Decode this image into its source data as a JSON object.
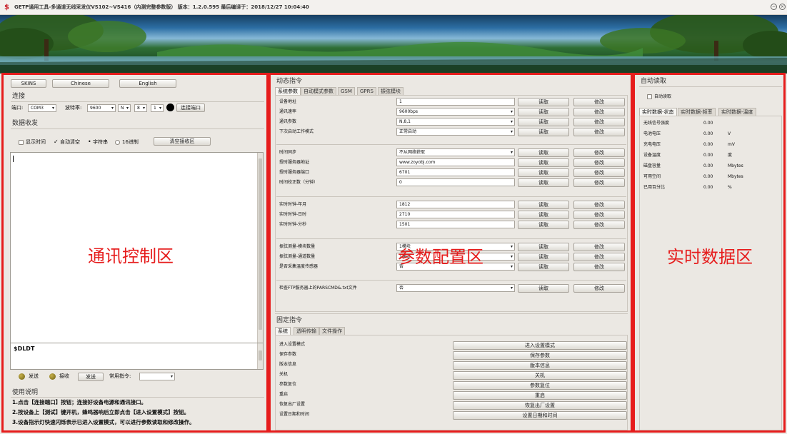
{
  "window": {
    "title": "GETP通用工具-多通道无线采发仪VS102~VS416（内测完整参数版） 版本：1.2.0.595 最后编译于：2018/12/27 10:04:40",
    "min_label": "−",
    "close_label": "×"
  },
  "left": {
    "skins_label": "SKINS",
    "chinese_label": "Chinese",
    "english_label": "English",
    "connect_title": "连接",
    "port_label": "端口:",
    "port_value": "COM3",
    "baud_label": "波特率:",
    "baud_value": "9600",
    "parity_value": "N",
    "databits_value": "8",
    "stopbits_value": "1",
    "connect_button": "连接端口",
    "recv_title": "数据收发",
    "show_time_label": "显示时间",
    "auto_clear_label": "自动清空",
    "string_label": "字符串",
    "hex_label": "16进制",
    "clear_button": "清空接收区",
    "overlay": "通讯控制区",
    "send_text": "$DLDT",
    "send_led_label": "发送",
    "recv_led_label": "接收",
    "send_button": "发送",
    "common_cmd_label": "常用指令:",
    "help_title": "使用说明",
    "help_lines": [
      "1.点击【连接端口】按钮；连接好设备电源和通讯接口。",
      "2.按设备上【测试】键开机，蜂鸣器响后立即点击【进入设置模式】按钮。",
      "3.设备指示灯快速闪烁表示已进入设置模式，可以进行参数读取和修改操作。"
    ]
  },
  "middle": {
    "dynamic_title": "动态指令",
    "tabs": [
      "系统参数",
      "自动模式参数",
      "GSM",
      "GPRS",
      "振弦模块"
    ],
    "read_label": "读取",
    "modify_label": "修改",
    "overlay": "参数配置区",
    "groups": [
      {
        "rows": [
          {
            "label": "设备地址",
            "kind": "input",
            "value": "1"
          },
          {
            "label": "通讯速率",
            "kind": "combo",
            "value": "9600bps"
          },
          {
            "label": "通讯参数",
            "kind": "combo",
            "value": "N,8,1"
          },
          {
            "label": "下次启动工作模式",
            "kind": "combo",
            "value": "正常启动"
          }
        ]
      },
      {
        "rows": [
          {
            "label": "时间同步",
            "kind": "combo",
            "value": "不从网络获取"
          },
          {
            "label": "授时服务器地址",
            "kind": "input",
            "value": "www.zoyobj.com"
          },
          {
            "label": "授时服务器端口",
            "kind": "input",
            "value": "6701"
          },
          {
            "label": "时间校正数（分钟）",
            "kind": "input",
            "value": "0"
          }
        ]
      },
      {
        "rows": [
          {
            "label": "实时时钟-年月",
            "kind": "input",
            "value": "1812"
          },
          {
            "label": "实时时钟-日时",
            "kind": "input",
            "value": "2710"
          },
          {
            "label": "实时时钟-分秒",
            "kind": "input",
            "value": "1501"
          }
        ]
      },
      {
        "rows": [
          {
            "label": "振弦测量-模块数量",
            "kind": "combo",
            "value": "1模块"
          },
          {
            "label": "振弦测量-通道数量",
            "kind": "combo",
            "value": "1通道"
          },
          {
            "label": "是否采集温度传感器",
            "kind": "combo",
            "value": "否"
          }
        ]
      },
      {
        "rows": [
          {
            "label": "检查FTP服务器上的PARSCMD&.txt文件",
            "kind": "combo",
            "value": "否"
          }
        ]
      }
    ],
    "fixed_title": "固定指令",
    "fixed_tabs": [
      "系统",
      "透明传输",
      "文件操作"
    ],
    "fixed_rows": [
      {
        "label": "进入设置模式",
        "button": "进入设置模式"
      },
      {
        "label": "保存参数",
        "button": "保存参数"
      },
      {
        "label": "版本信息",
        "button": "版本信息"
      },
      {
        "label": "关机",
        "button": "关机"
      },
      {
        "label": "参数复位",
        "button": "参数复位"
      },
      {
        "label": "重启",
        "button": "重启"
      },
      {
        "label": "恢复出厂设置",
        "button": "恢复出厂设置"
      },
      {
        "label": "设置日期和时间",
        "button": "设置日期和时间"
      }
    ]
  },
  "right": {
    "title": "自动读取",
    "auto_read_label": "自动读取",
    "tabs": [
      "实时数据-状态",
      "实时数据-频率",
      "实时数据-温度"
    ],
    "overlay": "实时数据区",
    "rows": [
      {
        "label": "无线信号强度",
        "value": "0.00",
        "unit": ""
      },
      {
        "label": "电池电压",
        "value": "0.00",
        "unit": "V"
      },
      {
        "label": "充电电压",
        "value": "0.00",
        "unit": "mV"
      },
      {
        "label": "设备温度",
        "value": "0.00",
        "unit": "度"
      },
      {
        "label": "磁盘容量",
        "value": "0.00",
        "unit": "Mbytes"
      },
      {
        "label": "可用空间",
        "value": "0.00",
        "unit": "Mbytes"
      },
      {
        "label": "已用百分比",
        "value": "0.00",
        "unit": "%"
      }
    ]
  },
  "colors": {
    "annotation": "#e61c1c",
    "panel": "#ebe8e3"
  }
}
